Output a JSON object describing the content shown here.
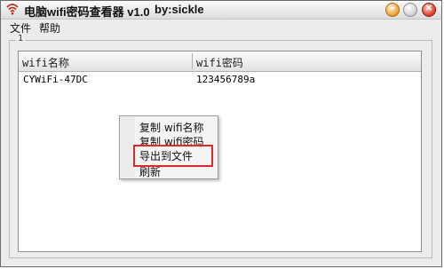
{
  "window": {
    "title": "电脑wifi密码查看器 v1.0",
    "author": "by:sickle",
    "controls": {
      "minimize": "–",
      "maximize": "",
      "close": "×"
    }
  },
  "menubar": {
    "file": "文件",
    "help": "帮助"
  },
  "group": {
    "label": "1"
  },
  "list": {
    "columns": [
      "wifi名称",
      "wifi密码"
    ],
    "rows": [
      [
        "CYWiFi-47DC",
        "123456789a"
      ]
    ]
  },
  "context_menu": {
    "items": [
      "复制 wifi名称",
      "复制 wifi密码",
      "导出到文件",
      "刷新"
    ],
    "highlighted_item": "导出到文件"
  },
  "colors": {
    "highlight_border": "#e0282b",
    "window_bg": "#ececec"
  }
}
